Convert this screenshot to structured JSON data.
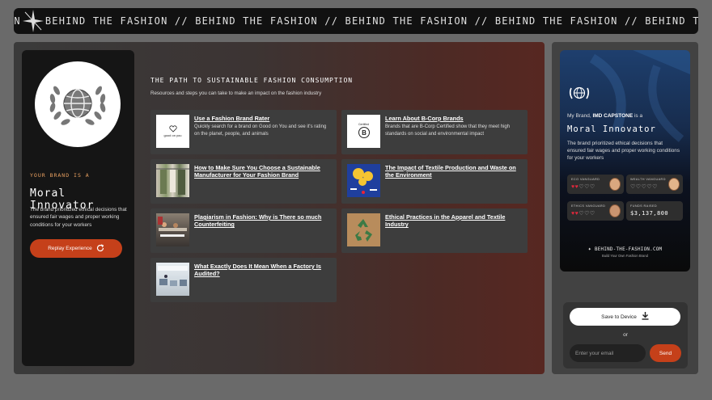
{
  "marquee": {
    "text": "BEHIND THE FASHION // BEHIND THE FASHION // BEHIND THE FASHION // BEHIND THE FASHION // BEHIND THE FASHION // BEHIND THE FASHION //",
    "prefix": "ON",
    "icon": "sparkle-star-icon"
  },
  "brand": {
    "logo_icon": "globe-laurel-icon",
    "kicker": "YOUR BRAND IS A",
    "title": "Moral Innovator",
    "description": "The brand prioritized ethical decisions that ensured fair wages and proper working conditions for your workers",
    "replay_label": "Replay Experience",
    "replay_icon": "refresh-icon"
  },
  "resources": {
    "title": "THE PATH TO SUSTAINABLE FASHION CONSUMPTION",
    "subtitle": "Resources and steps you can take to make an impact on the fashion industry",
    "items": [
      {
        "title": "Use a Fashion Brand Rater",
        "description": "Quickly search for a brand on Good on You and see it's rating on the planet, people, and animals",
        "thumb": "good-on-you-logo",
        "thumb_text": "good on you"
      },
      {
        "title": "Learn About B-Corp Brands",
        "description": "Brands that are B-Corp Certified show that they meet high standards on social and environmental impact",
        "thumb": "b-corp-logo",
        "thumb_text": "Certified"
      },
      {
        "title": "How to Make Sure You Choose a Sustainable Manufacturer for Your Fashion Brand",
        "description": "",
        "thumb": "clothing-rack-photo"
      },
      {
        "title": "The Impact of Textile Production and Waste on the Environment",
        "description": "",
        "thumb": "infographic-thumbnail"
      },
      {
        "title": "Plagiarism in Fashion: Why is There so much Counterfeiting",
        "description": "",
        "thumb": "factory-workers-photo"
      },
      {
        "title": "Ethical Practices in the Apparel and Textile Industry",
        "description": "",
        "thumb": "recycle-cardboard-photo"
      },
      {
        "title": "What Exactly Does It Mean When a Factory Is Audited?",
        "description": "",
        "thumb": "factory-floor-photo"
      }
    ]
  },
  "card": {
    "icon": "globe-laurel-icon",
    "intro": "My Brand, ",
    "brand_name": "IMD CAPSTONE",
    "intro_end": " is a",
    "title": "Moral Innovator",
    "description": "The brand prioritized ethical decisions that ensured fair wages and proper working conditions for your workers",
    "stats": [
      {
        "label": "ECO VANGUARD",
        "rating": 2,
        "max": 5
      },
      {
        "label": "WEALTH VANGUARD",
        "rating": 0,
        "max": 5
      },
      {
        "label": "ETHICS VANGUARD",
        "rating": 2,
        "max": 5
      },
      {
        "label": "FUNDS RAISED",
        "value": "$3,137,800"
      }
    ],
    "site": "BEHIND-THE-FASHION.COM",
    "site_tagline": "Build Your Own Fashion Brand"
  },
  "share": {
    "save_label": "Save to Device",
    "save_icon": "download-icon",
    "or_label": "or",
    "email_placeholder": "Enter your email",
    "send_label": "Send"
  },
  "colors": {
    "accent": "#c5401a",
    "heart": "#e0283c",
    "kicker": "#e8a060"
  }
}
